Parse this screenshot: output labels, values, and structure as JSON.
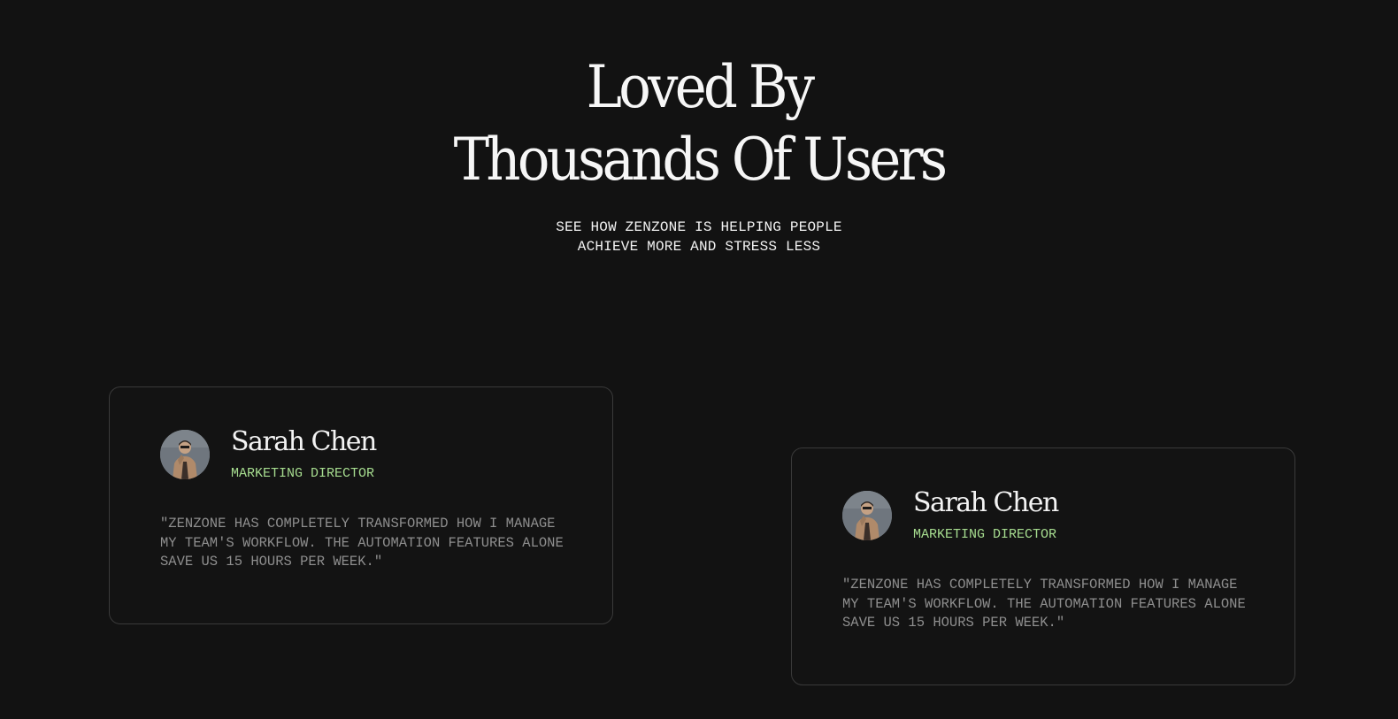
{
  "hero": {
    "title_line1": "Loved By",
    "title_line2": "Thousands Of Users",
    "subtitle_line1": "SEE HOW ZENZONE IS HELPING PEOPLE",
    "subtitle_line2": "ACHIEVE MORE AND STRESS LESS"
  },
  "testimonials": [
    {
      "avatar_icon": "person-avatar",
      "name": "Sarah Chen",
      "role": "MARKETING DIRECTOR",
      "quote_lines": [
        "\"ZENZONE HAS COMPLETELY TRANSFORMED HOW I MANAGE",
        "MY TEAM'S WORKFLOW. THE AUTOMATION FEATURES ALONE",
        "SAVE US 15 HOURS PER WEEK.\""
      ]
    },
    {
      "avatar_icon": "person-avatar",
      "name": "Sarah Chen",
      "role": "MARKETING DIRECTOR",
      "quote_lines": [
        "\"ZENZONE HAS COMPLETELY TRANSFORMED HOW I MANAGE",
        "MY TEAM'S WORKFLOW. THE AUTOMATION FEATURES ALONE",
        "SAVE US 15 HOURS PER WEEK.\""
      ]
    }
  ],
  "colors": {
    "background": "#121212",
    "card_border": "#3a3a3a",
    "role_accent": "#a6dc8f",
    "quote_text": "#8e8e8e"
  }
}
